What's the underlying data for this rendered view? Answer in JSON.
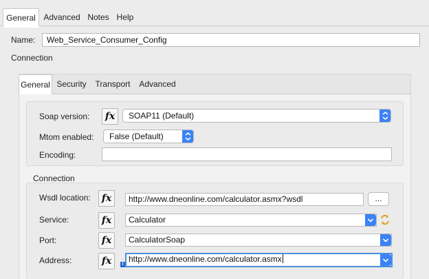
{
  "top_tabs": [
    "General",
    "Advanced",
    "Notes",
    "Help"
  ],
  "name_label": "Name:",
  "name_value": "Web_Service_Consumer_Config",
  "connection_section_label": "Connection",
  "inner_tabs": [
    "General",
    "Security",
    "Transport",
    "Advanced"
  ],
  "fx_symbol": "fx",
  "general_fields": {
    "soap_version_label": "Soap version:",
    "soap_version_value": "SOAP11 (Default)",
    "mtom_label": "Mtom enabled:",
    "mtom_value": "False (Default)",
    "encoding_label": "Encoding:",
    "encoding_value": ""
  },
  "connection_group_label": "Connection",
  "connection_fields": {
    "wsdl_label": "Wsdl location:",
    "wsdl_value": "http://www.dneonline.com/calculator.asmx?wsdl",
    "browse_label": "...",
    "service_label": "Service:",
    "service_value": "Calculator",
    "port_label": "Port:",
    "port_value": "CalculatorSoap",
    "address_label": "Address:",
    "address_value": "http://www.dneonline.com/calculator.asmx",
    "info_glyph": "i"
  },
  "colors": {
    "accent": "#3b82f6",
    "focus_ring": "#4a90d9",
    "refresh_icon": "#e0a020"
  }
}
